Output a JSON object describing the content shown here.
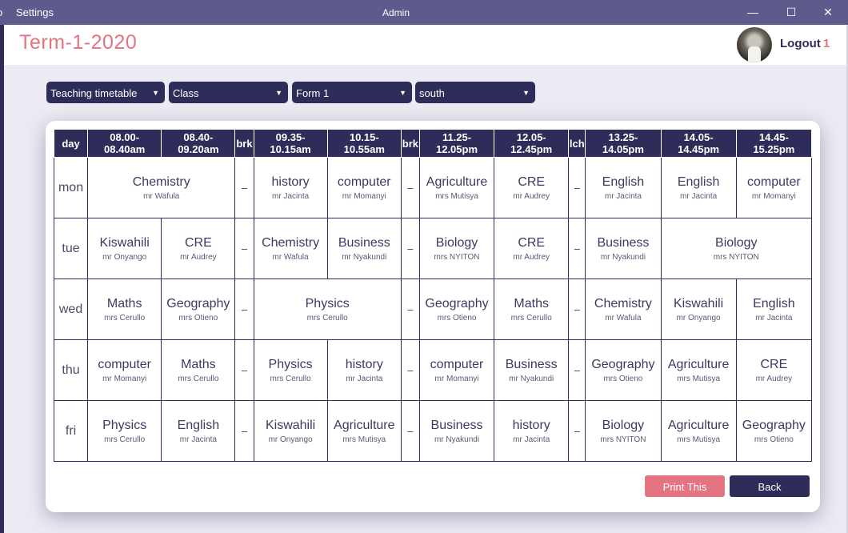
{
  "window": {
    "menu_clip": "o",
    "menu_settings": "Settings",
    "title": "Admin",
    "minimize": "—",
    "maximize": "☐",
    "close": "✕"
  },
  "header": {
    "term": "Term-1-2020",
    "logout_label": "Logout",
    "logout_count": "1"
  },
  "filters": {
    "type": "Teaching timetable",
    "category": "Class",
    "form": "Form 1",
    "stream": "south"
  },
  "timetable": {
    "headers": [
      {
        "text": "day",
        "w": 42
      },
      {
        "text": "08.00-\n08.40am",
        "w": 92
      },
      {
        "text": "08.40-\n09.20am",
        "w": 92
      },
      {
        "text": "brk",
        "w": 23
      },
      {
        "text": "09.35-\n10.15am",
        "w": 92
      },
      {
        "text": "10.15-\n10.55am",
        "w": 92
      },
      {
        "text": "brk",
        "w": 23
      },
      {
        "text": "11.25-\n12.05pm",
        "w": 93
      },
      {
        "text": "12.05-\n12.45pm",
        "w": 93
      },
      {
        "text": "lch",
        "w": 21
      },
      {
        "text": "13.25-\n14.05pm",
        "w": 94
      },
      {
        "text": "14.05-\n14.45pm",
        "w": 94
      },
      {
        "text": "14.45-\n15.25pm",
        "w": 94
      }
    ],
    "rows": [
      {
        "day": "mon",
        "cells": [
          {
            "subject": "Chemistry",
            "teacher": "mr Wafula",
            "span": 2
          },
          {
            "brk": "–"
          },
          {
            "subject": "history",
            "teacher": "mr Jacinta"
          },
          {
            "subject": "computer",
            "teacher": "mr Momanyi"
          },
          {
            "brk": "–"
          },
          {
            "subject": "Agriculture",
            "teacher": "mrs Mutisya"
          },
          {
            "subject": "CRE",
            "teacher": "mr Audrey"
          },
          {
            "brk": "–"
          },
          {
            "subject": "English",
            "teacher": "mr Jacinta"
          },
          {
            "subject": "English",
            "teacher": "mr Jacinta"
          },
          {
            "subject": "computer",
            "teacher": "mr Momanyi"
          }
        ]
      },
      {
        "day": "tue",
        "cells": [
          {
            "subject": "Kiswahili",
            "teacher": "mr Onyango"
          },
          {
            "subject": "CRE",
            "teacher": "mr Audrey"
          },
          {
            "brk": "–"
          },
          {
            "subject": "Chemistry",
            "teacher": "mr Wafula"
          },
          {
            "subject": "Business",
            "teacher": "mr Nyakundi"
          },
          {
            "brk": "–"
          },
          {
            "subject": "Biology",
            "teacher": "mrs NYITON"
          },
          {
            "subject": "CRE",
            "teacher": "mr Audrey"
          },
          {
            "brk": "–"
          },
          {
            "subject": "Business",
            "teacher": "mr Nyakundi"
          },
          {
            "subject": "Biology",
            "teacher": "mrs NYITON",
            "span": 2
          }
        ]
      },
      {
        "day": "wed",
        "cells": [
          {
            "subject": "Maths",
            "teacher": "mrs Cerullo"
          },
          {
            "subject": "Geography",
            "teacher": "mrs Otieno"
          },
          {
            "brk": "–"
          },
          {
            "subject": "Physics",
            "teacher": "mrs Cerullo",
            "span": 2
          },
          {
            "brk": "–"
          },
          {
            "subject": "Geography",
            "teacher": "mrs Otieno"
          },
          {
            "subject": "Maths",
            "teacher": "mrs Cerullo"
          },
          {
            "brk": "–"
          },
          {
            "subject": "Chemistry",
            "teacher": "mr Wafula"
          },
          {
            "subject": "Kiswahili",
            "teacher": "mr Onyango"
          },
          {
            "subject": "English",
            "teacher": "mr Jacinta"
          }
        ]
      },
      {
        "day": "thu",
        "cells": [
          {
            "subject": "computer",
            "teacher": "mr Momanyi"
          },
          {
            "subject": "Maths",
            "teacher": "mrs Cerullo"
          },
          {
            "brk": "–"
          },
          {
            "subject": "Physics",
            "teacher": "mrs Cerullo"
          },
          {
            "subject": "history",
            "teacher": "mr Jacinta"
          },
          {
            "brk": "–"
          },
          {
            "subject": "computer",
            "teacher": "mr Momanyi"
          },
          {
            "subject": "Business",
            "teacher": "mr Nyakundi"
          },
          {
            "brk": "–"
          },
          {
            "subject": "Geography",
            "teacher": "mrs Otieno"
          },
          {
            "subject": "Agriculture",
            "teacher": "mrs Mutisya"
          },
          {
            "subject": "CRE",
            "teacher": "mr Audrey"
          }
        ]
      },
      {
        "day": "fri",
        "cells": [
          {
            "subject": "Physics",
            "teacher": "mrs Cerullo"
          },
          {
            "subject": "English",
            "teacher": "mr Jacinta"
          },
          {
            "brk": "–"
          },
          {
            "subject": "Kiswahili",
            "teacher": "mr Onyango"
          },
          {
            "subject": "Agriculture",
            "teacher": "mrs Mutisya"
          },
          {
            "brk": "–"
          },
          {
            "subject": "Business",
            "teacher": "mr Nyakundi"
          },
          {
            "subject": "history",
            "teacher": "mr Jacinta"
          },
          {
            "brk": "–"
          },
          {
            "subject": "Biology",
            "teacher": "mrs NYITON"
          },
          {
            "subject": "Agriculture",
            "teacher": "mrs Mutisya"
          },
          {
            "subject": "Geography",
            "teacher": "mrs Otieno"
          }
        ]
      }
    ]
  },
  "actions": {
    "print": "Print This",
    "back": "Back"
  },
  "colors": {
    "accent": "#e47481",
    "primary": "#2e2c58",
    "titlebar": "#5d5a8c"
  }
}
